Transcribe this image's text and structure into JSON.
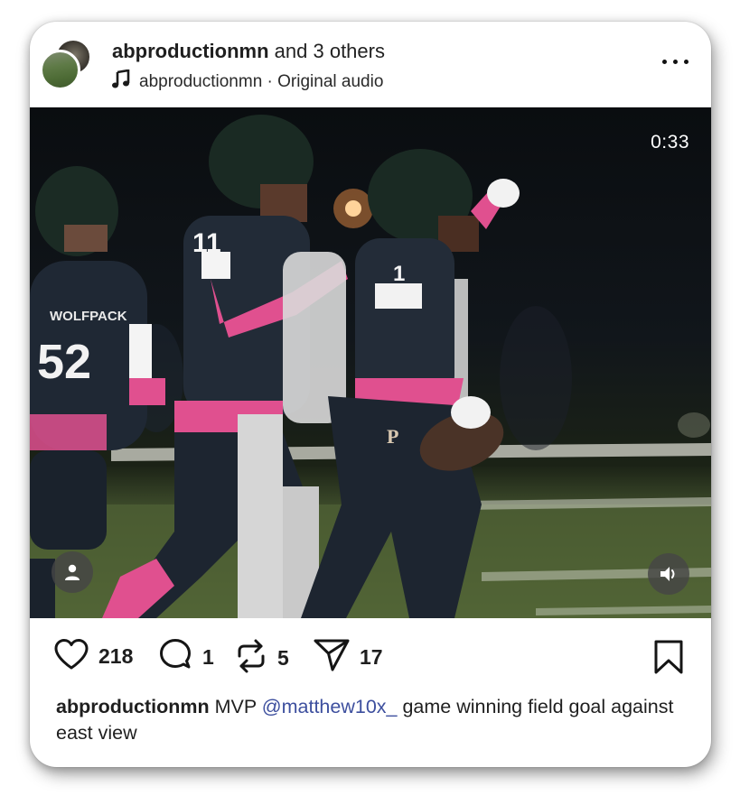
{
  "post": {
    "author": "abproductionmn",
    "coauthors_text": "and 3 others",
    "audio_author": "abproductionmn",
    "audio_separator": "·",
    "audio_label": "Original audio",
    "more_label": "more-options"
  },
  "video": {
    "duration": "0:33",
    "jersey_numbers": [
      "52",
      "11",
      "1"
    ],
    "team_text": "WOLFPACK"
  },
  "actions": {
    "likes": "218",
    "comments": "1",
    "reposts": "5",
    "shares": "17"
  },
  "caption": {
    "author": "abproductionmn",
    "text_before": "MVP",
    "mention": "@matthew10x_",
    "text_after": "game winning field goal against east view"
  },
  "colors": {
    "mention": "#3d4f9e",
    "jersey_navy": "#1f2834",
    "accent_pink": "#e0508f"
  },
  "icons": [
    "music-note-icon",
    "more-options-icon",
    "user-icon",
    "speaker-icon",
    "heart-icon",
    "comment-icon",
    "repost-icon",
    "share-icon",
    "bookmark-icon"
  ]
}
